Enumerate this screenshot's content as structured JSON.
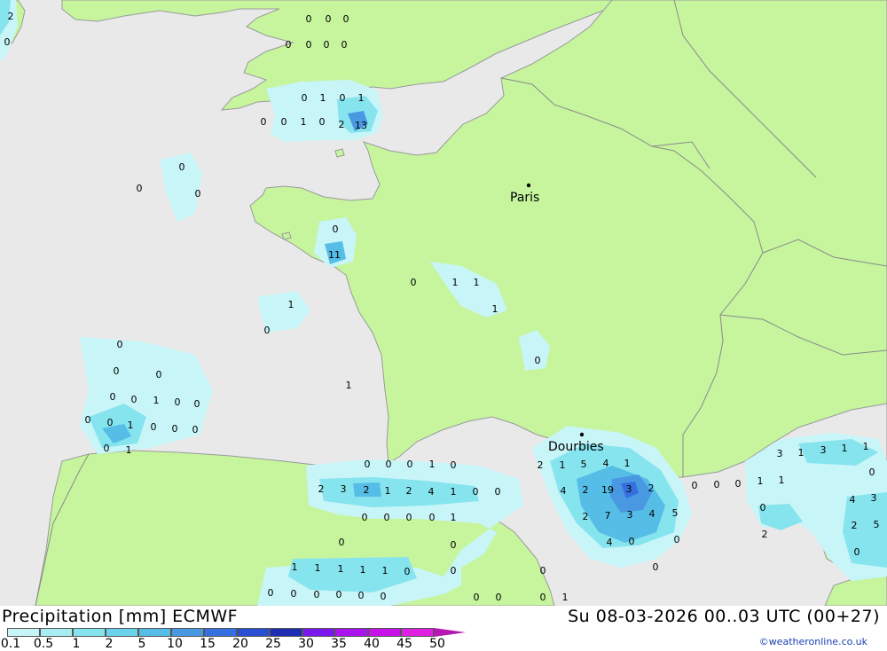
{
  "footer": {
    "title": "Precipitation [mm] ECMWF",
    "datetime": "Su 08-03-2026 00..03 UTC (00+27)",
    "credit": "©weatheronline.co.uk"
  },
  "legend": {
    "labels": [
      "0.1",
      "0.5",
      "1",
      "2",
      "5",
      "10",
      "15",
      "20",
      "25",
      "30",
      "35",
      "40",
      "45",
      "50"
    ],
    "colors": [
      "#c8f5f8",
      "#a6eef2",
      "#86e4ee",
      "#6ad3ea",
      "#55bde6",
      "#4898e2",
      "#3670e0",
      "#2a4ed2",
      "#1e2eb4",
      "#7b18ee",
      "#a813ee",
      "#c810e8",
      "#e020e0",
      "#b418b0"
    ]
  },
  "cities": [
    {
      "name": "Paris"
    },
    {
      "name": "Dourbies"
    }
  ],
  "values": [
    {
      "v": "2"
    },
    {
      "v": "0"
    },
    {
      "v": "0"
    },
    {
      "v": "0"
    },
    {
      "v": "0"
    },
    {
      "v": "0"
    },
    {
      "v": "0"
    },
    {
      "v": "0"
    },
    {
      "v": "0"
    },
    {
      "v": "0"
    },
    {
      "v": "1"
    },
    {
      "v": "0"
    },
    {
      "v": "1"
    },
    {
      "v": "0"
    },
    {
      "v": "0"
    },
    {
      "v": "1"
    },
    {
      "v": "0"
    },
    {
      "v": "2"
    },
    {
      "v": "13"
    },
    {
      "v": "0"
    },
    {
      "v": "0"
    },
    {
      "v": "0"
    },
    {
      "v": "0"
    },
    {
      "v": "11"
    },
    {
      "v": "0"
    },
    {
      "v": "1"
    },
    {
      "v": "1"
    },
    {
      "v": "1"
    },
    {
      "v": "1"
    },
    {
      "v": "0"
    },
    {
      "v": "0"
    },
    {
      "v": "0"
    },
    {
      "v": "0"
    },
    {
      "v": "0"
    },
    {
      "v": "0"
    },
    {
      "v": "0"
    },
    {
      "v": "1"
    },
    {
      "v": "0"
    },
    {
      "v": "0"
    },
    {
      "v": "0"
    },
    {
      "v": "0"
    },
    {
      "v": "1"
    },
    {
      "v": "0"
    },
    {
      "v": "0"
    },
    {
      "v": "0"
    },
    {
      "v": "1"
    },
    {
      "v": "0"
    },
    {
      "v": "1"
    },
    {
      "v": "0"
    },
    {
      "v": "0"
    },
    {
      "v": "0"
    },
    {
      "v": "1"
    },
    {
      "v": "2"
    },
    {
      "v": "3"
    },
    {
      "v": "2"
    },
    {
      "v": "1"
    },
    {
      "v": "2"
    },
    {
      "v": "4"
    },
    {
      "v": "1"
    },
    {
      "v": "0"
    },
    {
      "v": "0"
    },
    {
      "v": "0"
    },
    {
      "v": "0"
    },
    {
      "v": "0"
    },
    {
      "v": "0"
    },
    {
      "v": "0"
    },
    {
      "v": "1"
    },
    {
      "v": "0"
    },
    {
      "v": "0"
    },
    {
      "v": "1"
    },
    {
      "v": "1"
    },
    {
      "v": "1"
    },
    {
      "v": "1"
    },
    {
      "v": "1"
    },
    {
      "v": "0"
    },
    {
      "v": "0"
    },
    {
      "v": "0"
    },
    {
      "v": "0"
    },
    {
      "v": "0"
    },
    {
      "v": "0"
    },
    {
      "v": "0"
    },
    {
      "v": "0"
    },
    {
      "v": "0"
    },
    {
      "v": "0"
    },
    {
      "v": "0"
    },
    {
      "v": "0"
    },
    {
      "v": "2"
    },
    {
      "v": "1"
    },
    {
      "v": "5"
    },
    {
      "v": "4"
    },
    {
      "v": "1"
    },
    {
      "v": "4"
    },
    {
      "v": "2"
    },
    {
      "v": "19"
    },
    {
      "v": "3"
    },
    {
      "v": "2"
    },
    {
      "v": "2"
    },
    {
      "v": "7"
    },
    {
      "v": "3"
    },
    {
      "v": "4"
    },
    {
      "v": "5"
    },
    {
      "v": "4"
    },
    {
      "v": "0"
    },
    {
      "v": "0"
    },
    {
      "v": "0"
    },
    {
      "v": "1"
    },
    {
      "v": "0"
    },
    {
      "v": "0"
    },
    {
      "v": "0"
    },
    {
      "v": "1"
    },
    {
      "v": "1"
    },
    {
      "v": "3"
    },
    {
      "v": "1"
    },
    {
      "v": "3"
    },
    {
      "v": "1"
    },
    {
      "v": "1"
    },
    {
      "v": "0"
    },
    {
      "v": "0"
    },
    {
      "v": "2"
    },
    {
      "v": "4"
    },
    {
      "v": "3"
    },
    {
      "v": "2"
    },
    {
      "v": "5"
    },
    {
      "v": "0"
    }
  ]
}
